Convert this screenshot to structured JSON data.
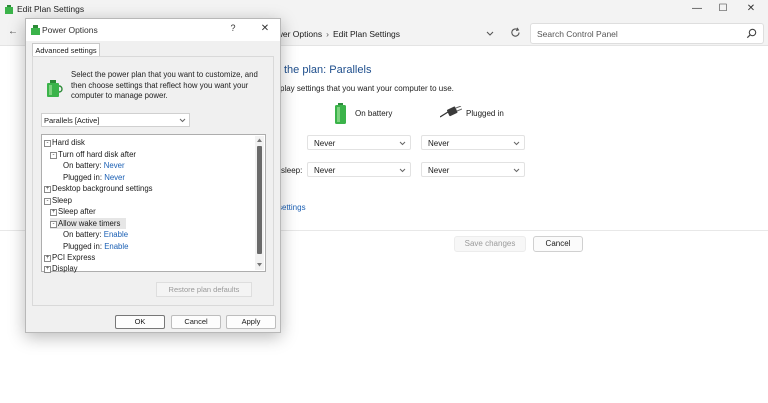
{
  "window": {
    "title": "Edit Plan Settings",
    "controls": [
      "—",
      "☐",
      "✕"
    ]
  },
  "address": {
    "breadcrumb": [
      "ower Options",
      "Edit Plan Settings"
    ],
    "search_placeholder": "Search Control Panel"
  },
  "main": {
    "heading": "the plan: Parallels",
    "subtext": "play settings that you want your computer to use.",
    "columns": {
      "battery": "On battery",
      "plugged": "Plugged in"
    },
    "rows": [
      {
        "label": "",
        "battery": "Never",
        "plugged": "Never"
      },
      {
        "label": "sleep:",
        "battery": "Never",
        "plugged": "Never"
      }
    ],
    "link": "settings",
    "save_label": "Save changes",
    "cancel_label": "Cancel"
  },
  "dialog": {
    "title": "Power Options",
    "help": "?",
    "close": "✕",
    "tab": "Advanced settings",
    "description": "Select the power plan that you want to customize, and then choose settings that reflect how you want your computer to manage power.",
    "plan": "Parallels [Active]",
    "tree": [
      {
        "level": 0,
        "toggle": "-",
        "text": "Hard disk"
      },
      {
        "level": 1,
        "toggle": "-",
        "text": "Turn off hard disk after"
      },
      {
        "level": 2,
        "toggle": "",
        "text": "On battery:",
        "value": "Never"
      },
      {
        "level": 2,
        "toggle": "",
        "text": "Plugged in:",
        "value": "Never"
      },
      {
        "level": 0,
        "toggle": "+",
        "text": "Desktop background settings"
      },
      {
        "level": 0,
        "toggle": "-",
        "text": "Sleep"
      },
      {
        "level": 1,
        "toggle": "+",
        "text": "Sleep after"
      },
      {
        "level": 1,
        "toggle": "-",
        "text": "Allow wake timers",
        "selected": true
      },
      {
        "level": 2,
        "toggle": "",
        "text": "On battery:",
        "value": "Enable"
      },
      {
        "level": 2,
        "toggle": "",
        "text": "Plugged in:",
        "value": "Enable"
      },
      {
        "level": 0,
        "toggle": "+",
        "text": "PCI Express"
      },
      {
        "level": 0,
        "toggle": "+",
        "text": "Display"
      }
    ],
    "restore_label": "Restore plan defaults",
    "ok_label": "OK",
    "cancel_label": "Cancel",
    "apply_label": "Apply"
  },
  "colors": {
    "link": "#1a5fb4",
    "heading": "#1e4e8c",
    "battery_green": "#3bb34a",
    "dialog_bg": "#f0f0f0"
  },
  "icons": [
    "power-plan-icon",
    "chevron-down-icon",
    "refresh-icon",
    "search-icon",
    "battery-icon",
    "plug-icon",
    "back-arrow-icon"
  ]
}
